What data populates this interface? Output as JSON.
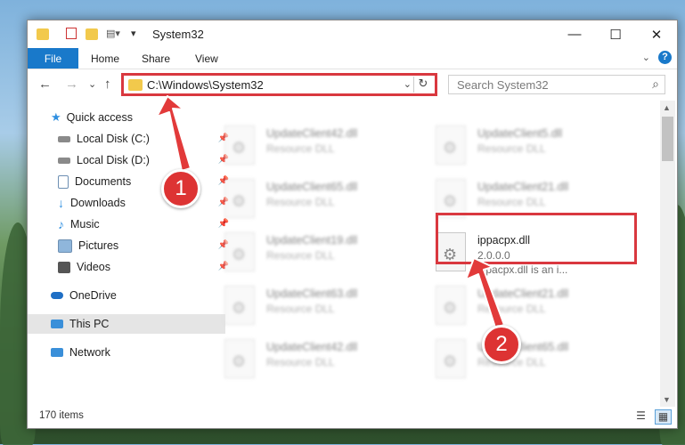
{
  "window": {
    "title": "System32"
  },
  "titlebar": {
    "minimize": "—",
    "maximize": "☐",
    "close": "✕"
  },
  "ribbon": {
    "file_tab": "File",
    "tabs": [
      "Home",
      "Share",
      "View"
    ],
    "help": "?",
    "expand": "⌄"
  },
  "nav": {
    "back": "←",
    "forward": "→",
    "recent": "⌄",
    "up": "↑",
    "address": "C:\\Windows\\System32",
    "address_drop": "⌄",
    "refresh": "↻",
    "search_placeholder": "Search System32"
  },
  "sidebar": {
    "items": [
      {
        "label": "Quick access",
        "icon": "star-icon",
        "color": "#2f8fe0"
      },
      {
        "label": "Local Disk (C:)",
        "icon": "drive-icon",
        "color": "#8a8a8a",
        "pinned": true
      },
      {
        "label": "Local Disk (D:)",
        "icon": "drive-icon",
        "color": "#8a8a8a",
        "pinned": true
      },
      {
        "label": "Documents",
        "icon": "documents-icon",
        "color": "#6d8fb3",
        "pinned": true
      },
      {
        "label": "Downloads",
        "icon": "downloads-icon",
        "color": "#2f8fe0",
        "pinned": true
      },
      {
        "label": "Music",
        "icon": "music-icon",
        "color": "#2f8fe0",
        "pinned": true
      },
      {
        "label": "Pictures",
        "icon": "pictures-icon",
        "color": "#6d8fb3",
        "pinned": true
      },
      {
        "label": "Videos",
        "icon": "videos-icon",
        "color": "#555555",
        "pinned": true
      },
      {
        "label": "OneDrive",
        "icon": "onedrive-icon",
        "color": "#1f6fc5"
      },
      {
        "label": "This PC",
        "icon": "computer-icon",
        "color": "#3a8fd9",
        "selected": true
      },
      {
        "label": "Network",
        "icon": "network-icon",
        "color": "#3a8fd9"
      }
    ]
  },
  "files": [
    {
      "name": "UpdateClient42.dll",
      "type": "Resource DLL"
    },
    {
      "name": "UpdateClient5.dll",
      "type": "Resource DLL"
    },
    {
      "name": "UpdateClient65.dll",
      "type": "Resource DLL"
    },
    {
      "name": "UpdateClient21.dll",
      "type": "Resource DLL"
    },
    {
      "name": "UpdateClient19.dll",
      "type": "Resource DLL"
    },
    {
      "name": "ippacpx.dll",
      "version": "2.0.0.0",
      "type": "ippacpx.dll is an i..."
    },
    {
      "name": "UpdateClient63.dll",
      "type": "Resource DLL"
    },
    {
      "name": "UpdateClient21.dll",
      "type": "Resource DLL"
    },
    {
      "name": "UpdateClient42.dll",
      "type": "Resource DLL"
    },
    {
      "name": "UpdateClient65.dll",
      "type": "Resource DLL"
    }
  ],
  "status": {
    "count": "170 items"
  },
  "annotations": {
    "step1": "1",
    "step2": "2"
  },
  "colors": {
    "accent": "#1979ca",
    "highlight": "#d9383f"
  }
}
